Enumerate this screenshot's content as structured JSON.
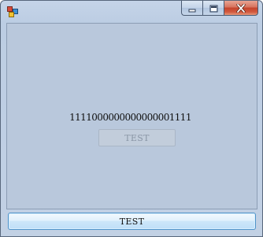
{
  "window": {
    "title": ""
  },
  "caption": {
    "minimize_icon": "minimize-icon",
    "maximize_icon": "maximize-icon",
    "close_icon": "close-icon"
  },
  "content": {
    "counter_text": "1111000000000000001111",
    "disabled_button_label": "TEST",
    "main_button_label": "TEST"
  },
  "colors": {
    "client_background": "#b9c8dc",
    "close_button": "#c4442c",
    "main_button_border": "#4f93c9"
  }
}
